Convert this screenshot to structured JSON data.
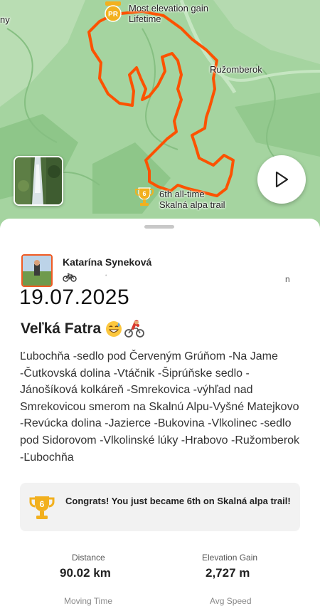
{
  "map": {
    "town_partial": "ny",
    "town": "Ružomberok",
    "segment_top": {
      "title": "Most elevation gain",
      "subtitle": "Lifetime",
      "badge": "PR"
    },
    "segment_bottom": {
      "title": "6th all-time",
      "subtitle": "Skalná alpa trail",
      "badge": "6"
    },
    "route_color": "#fc5200",
    "play_icon": "play-icon"
  },
  "activity": {
    "author": "Katarína Syneková",
    "sport_icon": "bike-icon",
    "partial_char": "n",
    "date": "19.07.2025",
    "title": "Veľká Fatra",
    "title_emojis": [
      "grin-sweat-emoji",
      "cyclist-emoji"
    ],
    "description": "Ľubochňa -sedlo pod Červeným Grúňom -Na Jame -Čutkovská dolina -Vtáčnik -Šiprúňske sedlo -Jánošíková kolkáreň -Smrekovica -výhľad nad Smrekovicou smerom na Skalnú Alpu-Vyšné Matejkovo -Revúcka dolina -Jazierce -Bukovina -Vlkolinec -sedlo pod Sidorovom -Vlkolinské lúky -Hrabovo -Ružomberok -Ľubochňa",
    "congrats": "Congrats! You just became 6th on Skalná alpa trail!",
    "congrats_badge": "6"
  },
  "stats": [
    {
      "label": "Distance",
      "value": "90.02 km"
    },
    {
      "label": "Elevation Gain",
      "value": "2,727 m"
    }
  ],
  "cut_labels": [
    "Moving Time",
    "Avg Speed"
  ]
}
